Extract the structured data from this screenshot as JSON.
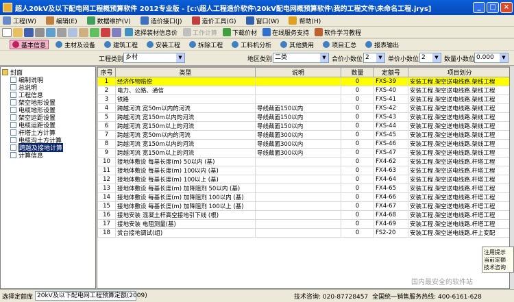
{
  "window": {
    "title": "超人20kV及以下配电网工程概预算软件 2012专业版 - [c:\\超人工程造价软件\\20kV配电网概预算软件\\我的工程文件\\未命名工程.jrys]"
  },
  "menu": [
    {
      "label": "工程(W)",
      "icon": "project-icon"
    },
    {
      "label": "编辑(E)",
      "icon": "edit-icon"
    },
    {
      "label": "数据维护(V)",
      "icon": "data-icon"
    },
    {
      "label": "造价接口(J)",
      "icon": "interface-icon"
    },
    {
      "label": "造价工具(G)",
      "icon": "tools-icon"
    },
    {
      "label": "窗口(W)",
      "icon": "window-icon"
    },
    {
      "label": "帮助(H)",
      "icon": "help-icon"
    }
  ],
  "toolbar": {
    "select_material": "选择装材信息价",
    "disabled_btn": "工作计算",
    "download_material": "下载价材",
    "online_support": "在线服务支持",
    "tutorial": "软件学习教程"
  },
  "tabs": [
    "基本信息",
    "主材及设备",
    "建筑工程",
    "安装工程",
    "拆除工程",
    "工料机分析",
    "其他费用",
    "项目汇总",
    "报表输出"
  ],
  "filters": {
    "project_type_label": "工程类别:",
    "project_type_value": "乡村",
    "region_label": "地区类别:",
    "region_value": "二类",
    "total_decimal_label": "合价小数位",
    "total_decimal_value": "2",
    "unit_decimal_label": "单价小数位",
    "unit_decimal_value": "2",
    "qty_decimal_label": "数量小数位",
    "qty_decimal_value": "0.000"
  },
  "tree": {
    "root": "封面",
    "items": [
      "编制说明",
      "总说明",
      "工程信息",
      "架空地形设置",
      "电缆地形设置",
      "架空运距设置",
      "电缆运距设置",
      "杆塔土方计算",
      "电缆沟土方计算",
      "跨越及接地计算",
      "计算信息"
    ],
    "selected_index": 9
  },
  "grid": {
    "headers": [
      "序号",
      "类型",
      "说明",
      "数量",
      "定额号",
      "项目划分"
    ],
    "rows": [
      [
        "1",
        "经济作物赔偿",
        "",
        "0",
        "FXS-39",
        "安装工程.架空送电线路.架线工程"
      ],
      [
        "2",
        "电力、公路、通信",
        "",
        "0",
        "FXS-40",
        "安装工程.架空送电线路.架线工程"
      ],
      [
        "3",
        "铁路",
        "",
        "0",
        "FXS-41",
        "安装工程.架空送电线路.架线工程"
      ],
      [
        "4",
        "跨越河流 宽50m以内的河流",
        "导线截面150以内",
        "0",
        "FXS-42",
        "安装工程.架空送电线路.架线工程"
      ],
      [
        "5",
        "跨越河流 宽150m以内的河流",
        "导线截面150以内",
        "0",
        "FXS-43",
        "安装工程.架空送电线路.架线工程"
      ],
      [
        "6",
        "跨越河流 宽150m以上的河流",
        "导线截面150以内",
        "0",
        "FXS-44",
        "安装工程.架空送电线路.架线工程"
      ],
      [
        "7",
        "跨越河流 宽50m以内的河流",
        "导线截面300以内",
        "0",
        "FXS-45",
        "安装工程.架空送电线路.架线工程"
      ],
      [
        "8",
        "跨越河流 宽150m以内的河流",
        "导线截面300以内",
        "0",
        "FXS-46",
        "安装工程.架空送电线路.架线工程"
      ],
      [
        "9",
        "跨越河流 宽150m以上的河流",
        "导线截面300以内",
        "0",
        "FXS-47",
        "安装工程.架空送电线路.架线工程"
      ],
      [
        "10",
        "接地体敷设 每基长度(m) 50以内 (基)",
        "",
        "0",
        "FX4-62",
        "安装工程.架空送电线路.杆塔工程"
      ],
      [
        "11",
        "接地体敷设 每基长度(m) 100以内 (基)",
        "",
        "0",
        "FX4-63",
        "安装工程.架空送电线路.杆塔工程"
      ],
      [
        "12",
        "接地体敷设 每基长度(m) 100以上 (基)",
        "",
        "0",
        "FX4-64",
        "安装工程.架空送电线路.杆塔工程"
      ],
      [
        "13",
        "接地体敷设 每基长度(m) 加降阻剂 50以内 (基)",
        "",
        "0",
        "FX4-65",
        "安装工程.架空送电线路.杆塔工程"
      ],
      [
        "14",
        "接地体敷设 每基长度(m) 加降阻剂 100以内 (基)",
        "",
        "0",
        "FX4-66",
        "安装工程.架空送电线路.杆塔工程"
      ],
      [
        "15",
        "接地体敷设 每基长度(m) 加降阻剂 100以上 (基)",
        "",
        "0",
        "FX4-67",
        "安装工程.架空送电线路.杆塔工程"
      ],
      [
        "16",
        "接地安装 混凝土杆高空接地引下线 (根)",
        "",
        "0",
        "FX4-68",
        "安装工程.架空送电线路.杆塔工程"
      ],
      [
        "17",
        "接地安装 电阻测量(基)",
        "",
        "0",
        "FX4-69",
        "安装工程.架空送电线路.杆塔工程"
      ],
      [
        "18",
        "赏台接地调试(组)",
        "",
        "0",
        "FS2-20",
        "安装工程.架空送电线路.杆上变配"
      ]
    ]
  },
  "hint": {
    "line1": "注用提示",
    "line2": "当前定额",
    "line3": "技术咨询"
  },
  "status": {
    "quota_label": "选择定额库",
    "quota_value": "20kV及以下配电网工程预算定额(2009)",
    "tech": "技术咨询: 020-87728457",
    "hotline": "全国统一销售服务热线: 400-6161-628"
  },
  "watermark": "国内最安全的软件站",
  "colors": {
    "highlight": "#ffff00",
    "title": "#0a5fd8",
    "active_tab": "#f0b4c8"
  }
}
